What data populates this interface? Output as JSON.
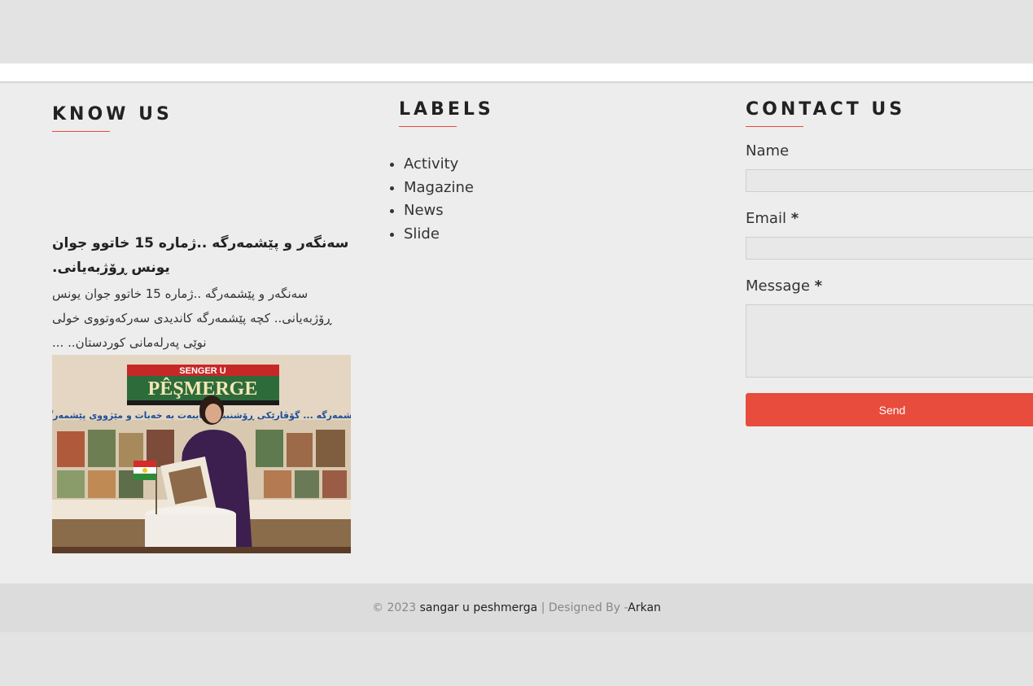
{
  "know_us": {
    "title": "KNOW US",
    "post": {
      "title": "سەنگەر و پێشمەرگە ..ژمارە 15 خاتوو جوان یونس ڕۆژبەیانی.",
      "snippet": "سەنگەر و پێشمەرگە ..ژمارە 15 خاتوو جوان یونس ڕۆژبەیانی.. کچە پێشمەرگە کاندیدی سەرکەوتووی خولی نوێی پەرلەمانی کوردستان.. ...",
      "image": {
        "header_small": "SENGER U",
        "header_big": "PÊŞMERGE",
        "banner_text": "پێشمەرگە ... گۆڤارێکی ڕۆشنبیری تایبەت بە خەبات و مێژووی پێشمەرگە"
      }
    }
  },
  "labels": {
    "title": "LABELS",
    "items": [
      {
        "label": "Activity"
      },
      {
        "label": "Magazine"
      },
      {
        "label": "News"
      },
      {
        "label": "Slide"
      }
    ]
  },
  "contact": {
    "title": "CONTACT US",
    "name_label": "Name",
    "name_value": "",
    "email_label": "Email",
    "email_value": "",
    "message_label": "Message",
    "message_value": "",
    "required_mark": "*",
    "send_label": "Send"
  },
  "footer": {
    "copyright": "© 2023",
    "site_name": "sangar u peshmerga",
    "separator": "| Designed By -",
    "designer": "Arkan"
  },
  "colors": {
    "accent": "#e74c3c",
    "page_background": "#e3e3e3",
    "widget_background": "#ededed",
    "footer_background": "#dcdcdc"
  }
}
